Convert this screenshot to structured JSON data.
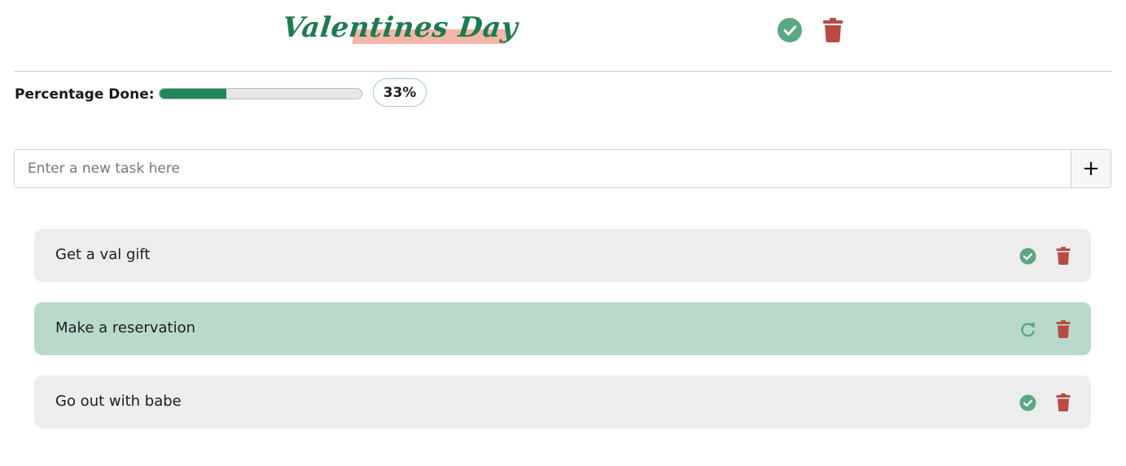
{
  "header": {
    "title": "Valentines Day",
    "actions": [
      {
        "icon": "check-circle-icon",
        "color": "#5aa782"
      },
      {
        "icon": "trash-icon",
        "color": "#b94b44"
      }
    ]
  },
  "progress": {
    "label": "Percentage Done:",
    "percent": 33,
    "percent_text": "33%"
  },
  "new_task": {
    "placeholder": "Enter a new task here",
    "add_label": "+"
  },
  "tasks": [
    {
      "label": "Get a val gift",
      "done": false,
      "toggle_icon": "check-circle-icon",
      "delete_icon": "trash-icon"
    },
    {
      "label": "Make a reservation",
      "done": true,
      "toggle_icon": "redo-icon",
      "delete_icon": "trash-icon"
    },
    {
      "label": "Go out with babe",
      "done": false,
      "toggle_icon": "check-circle-icon",
      "delete_icon": "trash-icon"
    }
  ],
  "colors": {
    "accent_green": "#1f8a58",
    "check_green": "#5aa782",
    "trash_red": "#b94b44",
    "done_background": "#b9dacb",
    "task_background": "#ededed",
    "title_highlight": "#f4b6a6"
  }
}
